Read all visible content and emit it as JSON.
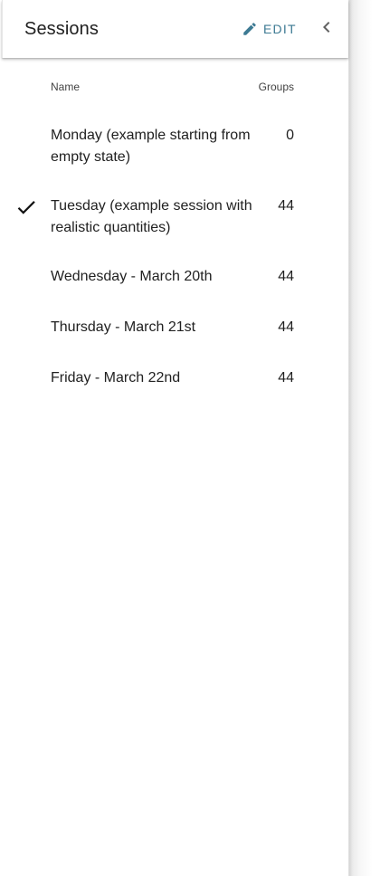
{
  "header": {
    "title": "Sessions",
    "edit_label": "EDIT",
    "edit_icon": "pencil-icon",
    "collapse_icon": "chevron-left-icon",
    "accent_color": "#3d7a93"
  },
  "table": {
    "columns": [
      "Name",
      "Groups"
    ],
    "rows": [
      {
        "name": "Monday (example starting from empty state)",
        "groups": "0",
        "selected": false
      },
      {
        "name": "Tuesday (example session with realistic quantities)",
        "groups": "44",
        "selected": true
      },
      {
        "name": "Wednesday - March 20th",
        "groups": "44",
        "selected": false
      },
      {
        "name": "Thursday - March 21st",
        "groups": "44",
        "selected": false
      },
      {
        "name": "Friday - March 22nd",
        "groups": "44",
        "selected": false
      }
    ]
  }
}
